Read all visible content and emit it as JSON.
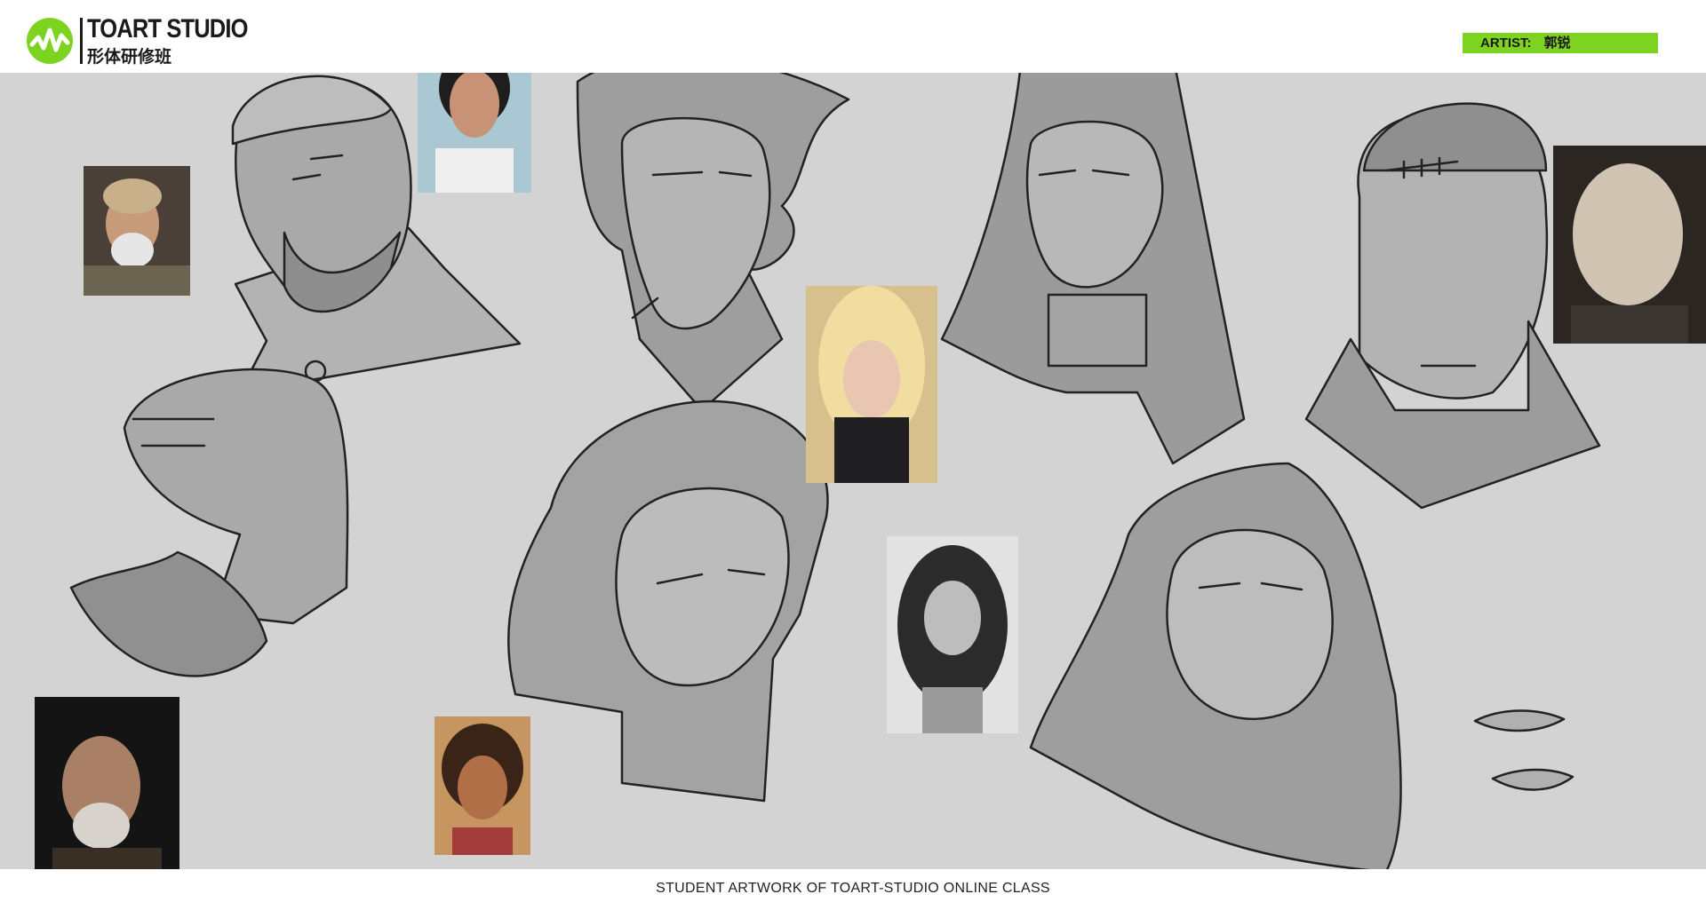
{
  "header": {
    "logo_title": "TOART STUDIO",
    "logo_subtitle": "形体研修班",
    "logo_icon": "waveform-circle-logo",
    "artist_label": "ARTIST:",
    "artist_name": "郭锐"
  },
  "colors": {
    "accent": "#7ed321",
    "canvas": "#d3d3d3",
    "ink": "#1a1a1a",
    "sketch_fill": "#a9a9a9"
  },
  "footer": {
    "caption": "STUDENT ARTWORK OF TOART-STUDIO ONLINE CLASS"
  }
}
